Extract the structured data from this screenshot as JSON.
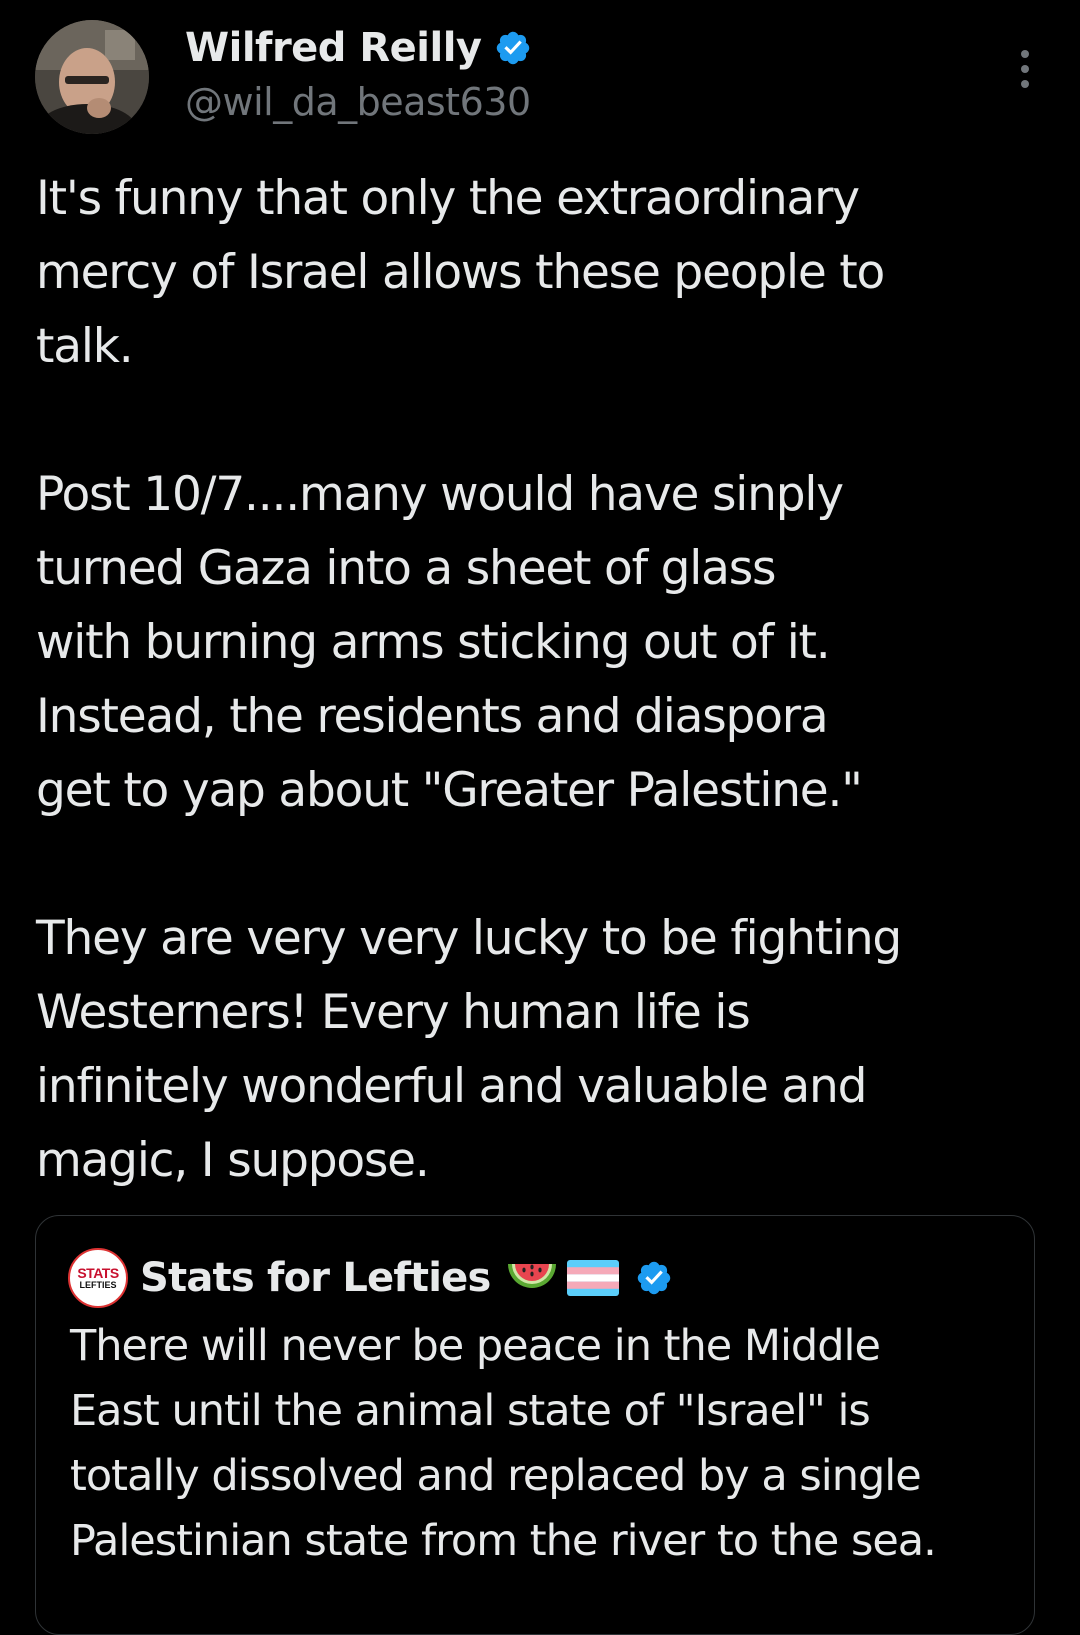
{
  "tweet": {
    "author": {
      "display_name": "Wilfred Reilly",
      "handle": "@wil_da_beast630",
      "verified_icon": "verified-badge-icon"
    },
    "body_paragraphs": [
      [
        "It's funny that only the extraordinary",
        "mercy of Israel allows these people to",
        "talk."
      ],
      [
        "Post 10/7....many would have sinply",
        "turned Gaza into a sheet of glass",
        "with burning arms sticking out of it.",
        "Instead, the residents and diaspora",
        "get to yap about \"Greater Palestine.\""
      ],
      [
        "They are very very lucky to be fighting",
        "Westerners! Every human life is",
        "infinitely wonderful and valuable and",
        "magic, I suppose."
      ]
    ]
  },
  "quote": {
    "author": {
      "display_name": "Stats for Lefties",
      "avatar_text_top": "STATS",
      "avatar_text_bottom": "LEFTIES",
      "emojis": [
        "watermelon-icon",
        "transgender-flag-icon"
      ],
      "verified_icon": "verified-badge-icon"
    },
    "text_lines": [
      "There will never be peace in the Middle",
      "East until the animal state of \"Israel\" is",
      "totally dissolved and replaced by a single",
      "Palestinian state from the river to the sea."
    ]
  },
  "colors": {
    "background": "#000000",
    "text_primary": "#e7e9ea",
    "text_secondary": "#71767b",
    "verified_blue": "#1d9bf0",
    "card_border": "#2f3336"
  }
}
